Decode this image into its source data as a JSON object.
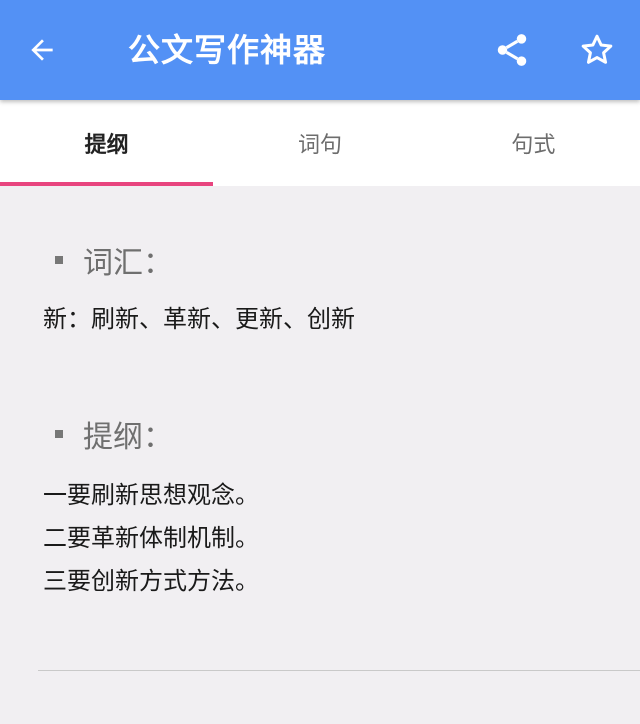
{
  "appbar": {
    "title": "公文写作神器",
    "back_icon": "arrow-left-icon",
    "share_icon": "share-icon",
    "favorite_icon": "star-outline-icon",
    "color": "#5391f5"
  },
  "tabs": [
    {
      "label": "提纲",
      "active": true
    },
    {
      "label": "词句",
      "active": false
    },
    {
      "label": "句式",
      "active": false
    }
  ],
  "tab_indicator_color": "#e8457f",
  "sections": {
    "vocab": {
      "heading": "词汇：",
      "lines": [
        "新：刷新、革新、更新、创新"
      ]
    },
    "outline": {
      "heading": "提纲：",
      "lines": [
        "一要刷新思想观念。",
        "二要革新体制机制。",
        "三要创新方式方法。"
      ]
    }
  }
}
